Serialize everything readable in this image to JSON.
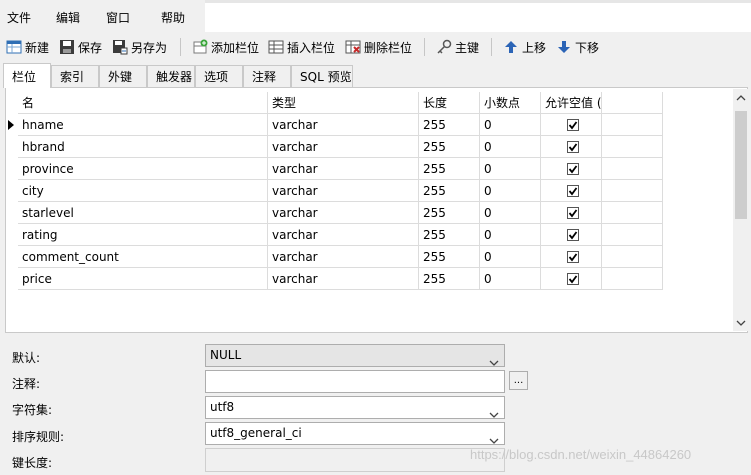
{
  "menu": {
    "items": [
      "文件",
      "编辑",
      "窗口",
      "帮助"
    ]
  },
  "toolbar": {
    "new_label": "新建",
    "save_label": "保存",
    "saveas_label": "另存为",
    "add_field_label": "添加栏位",
    "insert_field_label": "插入栏位",
    "delete_field_label": "删除栏位",
    "primary_key_label": "主键",
    "move_up_label": "上移",
    "move_down_label": "下移"
  },
  "tabs": [
    "栏位",
    "索引",
    "外键",
    "触发器",
    "选项",
    "注释",
    "SQL 预览"
  ],
  "grid": {
    "headers": [
      "名",
      "类型",
      "长度",
      "小数点",
      "允许空值 ("
    ],
    "rows": [
      {
        "name": "hname",
        "type": "varchar",
        "length": "255",
        "decimals": "0",
        "nullable": true
      },
      {
        "name": "hbrand",
        "type": "varchar",
        "length": "255",
        "decimals": "0",
        "nullable": true
      },
      {
        "name": "province",
        "type": "varchar",
        "length": "255",
        "decimals": "0",
        "nullable": true
      },
      {
        "name": "city",
        "type": "varchar",
        "length": "255",
        "decimals": "0",
        "nullable": true
      },
      {
        "name": "starlevel",
        "type": "varchar",
        "length": "255",
        "decimals": "0",
        "nullable": true
      },
      {
        "name": "rating",
        "type": "varchar",
        "length": "255",
        "decimals": "0",
        "nullable": true
      },
      {
        "name": "comment_count",
        "type": "varchar",
        "length": "255",
        "decimals": "0",
        "nullable": true
      },
      {
        "name": "price",
        "type": "varchar",
        "length": "255",
        "decimals": "0",
        "nullable": true
      }
    ]
  },
  "properties": {
    "default_label": "默认:",
    "default_value": "NULL",
    "comment_label": "注释:",
    "comment_value": "",
    "comment_button": "...",
    "charset_label": "字符集:",
    "charset_value": "utf8",
    "collation_label": "排序规则:",
    "collation_value": "utf8_general_ci",
    "keylength_label": "键长度:",
    "keylength_value": ""
  },
  "watermark": "https://blog.csdn.net/weixin_44864260"
}
